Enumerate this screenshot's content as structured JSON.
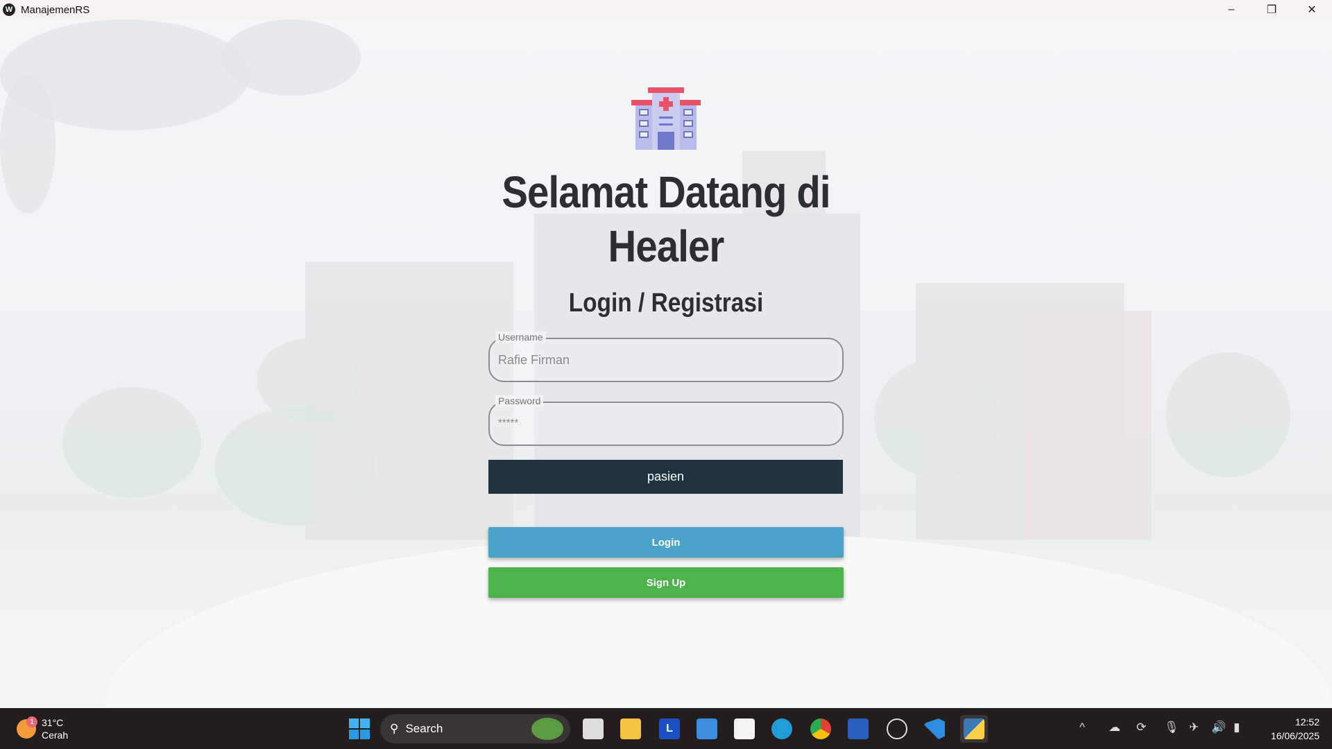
{
  "window": {
    "title": "ManajemenRS"
  },
  "login": {
    "title_line1": "Selamat Datang di",
    "title_line2": "Healer",
    "subtitle": "Login / Registrasi",
    "username_label": "Username",
    "username_value": "Rafie Firman",
    "password_label": "Password",
    "password_value": "*****",
    "role_selected": "pasien",
    "login_label": "Login",
    "signup_label": "Sign Up"
  },
  "taskbar": {
    "weather_temp": "31°C",
    "weather_desc": "Cerah",
    "weather_badge": "1",
    "search_placeholder": "Search",
    "time": "12:52",
    "date": "16/06/2025"
  },
  "colors": {
    "role_bg": "#1e3441",
    "login_bg": "#4aa4c8",
    "signup_bg": "#4cb34c"
  }
}
